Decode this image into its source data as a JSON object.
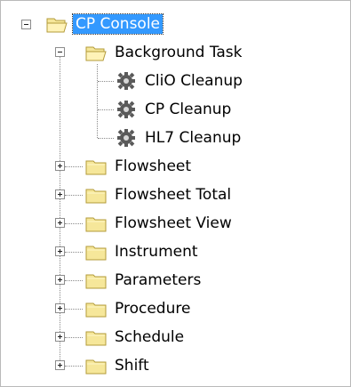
{
  "tree": {
    "root": {
      "label": "CP Console",
      "state": "expanded",
      "selected": true
    },
    "background_task": {
      "label": "Background Task",
      "state": "expanded",
      "children": [
        "CliO Cleanup",
        "CP Cleanup",
        "HL7 Cleanup"
      ]
    },
    "folders": [
      "Flowsheet",
      "Flowsheet Total",
      "Flowsheet View",
      "Instrument",
      "Parameters",
      "Procedure",
      "Schedule",
      "Shift"
    ]
  },
  "colors": {
    "selection": "#3399ff",
    "folder_fill": "#f6e79a",
    "folder_edge": "#b39b3a",
    "dotted_line": "#8a8a8a"
  },
  "icons": {
    "expander_open": "minus-box",
    "expander_closed": "plus-box",
    "folder": "folder-icon",
    "task": "gear-icon"
  }
}
